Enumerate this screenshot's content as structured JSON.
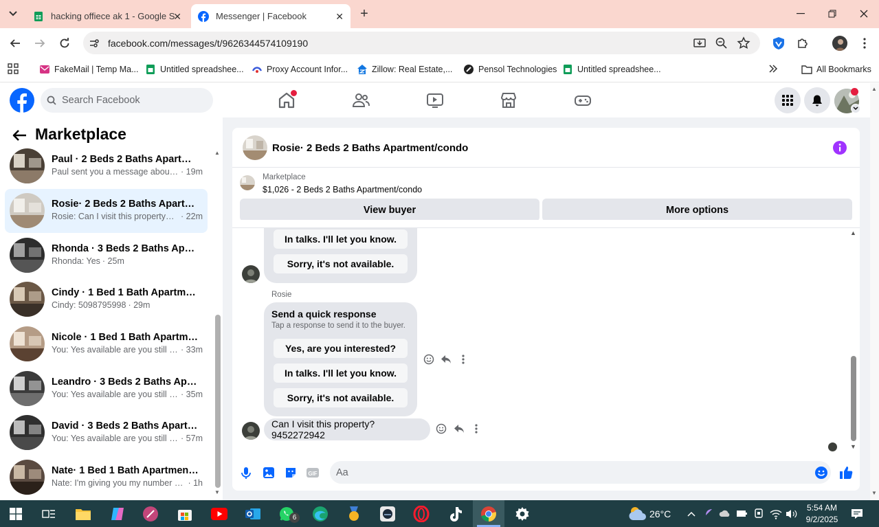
{
  "browser": {
    "tabs": [
      {
        "title": "hacking offiece ak 1 - Google S",
        "icon": "google-sheets-icon"
      },
      {
        "title": "Messenger | Facebook",
        "icon": "facebook-icon"
      }
    ],
    "url": "facebook.com/messages/t/9626344574109190",
    "bookmarks": [
      {
        "label": "FakeMail | Temp Ma...",
        "icon": "fakemail-icon"
      },
      {
        "label": "Untitled spreadshee...",
        "icon": "google-sheets-icon"
      },
      {
        "label": "Proxy Account Infor...",
        "icon": "proxy-icon"
      },
      {
        "label": "Zillow: Real Estate,...",
        "icon": "zillow-icon"
      },
      {
        "label": "Pensol Technologies",
        "icon": "pensol-icon"
      },
      {
        "label": "Untitled spreadshee...",
        "icon": "google-sheets-icon"
      }
    ],
    "all_bookmarks": "All Bookmarks"
  },
  "facebook": {
    "search_placeholder": "Search Facebook"
  },
  "marketplace": {
    "title": "Marketplace",
    "conversations": [
      {
        "name": "Paul · 2 Beds 2 Baths Apartment...",
        "preview": "Paul sent you a message about y...",
        "time": "· 19m",
        "selected": false
      },
      {
        "name": "Rosie· 2 Beds 2 Baths Apartmen...",
        "preview": "Rosie: Can I visit this property? 9...",
        "time": "· 22m",
        "selected": true
      },
      {
        "name": "Rhonda · 3 Beds 2 Baths Apartm...",
        "preview": "Rhonda: Yes",
        "time": "· 25m",
        "selected": false
      },
      {
        "name": "Cindy · 1 Bed 1 Bath Apartment/...",
        "preview": "Cindy: 5098795998",
        "time": "· 29m",
        "selected": false
      },
      {
        "name": "Nicole · 1 Bed 1 Bath Apartment...",
        "preview": "You: Yes available are you still int...",
        "time": "· 33m",
        "selected": false
      },
      {
        "name": "Leandro · 3 Beds 2 Baths Apart...",
        "preview": "You: Yes available are you still int...",
        "time": "· 35m",
        "selected": false
      },
      {
        "name": "David · 3 Beds 2 Baths Apartme...",
        "preview": "You: Yes available are you still int...",
        "time": "· 57m",
        "selected": false
      },
      {
        "name": "Nate· 1 Bed 1 Bath Apartment/c...",
        "preview": "Nate: I'm giving you my number b...",
        "time": "· 1h",
        "selected": false
      }
    ]
  },
  "chat": {
    "title": "Rosie· 2 Beds 2 Baths Apartment/condo",
    "listing_label": "Marketplace",
    "listing_price": "$1,026 - 2 Beds 2 Baths Apartment/condo",
    "view_buyer": "View buyer",
    "more_options": "More options",
    "first_block": {
      "options": [
        "In talks. I'll let you know.",
        "Sorry, it's not available."
      ]
    },
    "second_block": {
      "sender": "Rosie",
      "heading": "Send a quick response",
      "subheading": "Tap a response to send it to the buyer.",
      "options": [
        "Yes, are you interested?",
        "In talks. I'll let you know.",
        "Sorry, it's not available."
      ]
    },
    "last_message": "Can I visit this property? 9452272942",
    "composer_placeholder": "Aa"
  },
  "taskbar": {
    "weather": "26°C",
    "time": "5:54 AM",
    "date": "9/2/2025",
    "whatsapp_badge": "6"
  }
}
